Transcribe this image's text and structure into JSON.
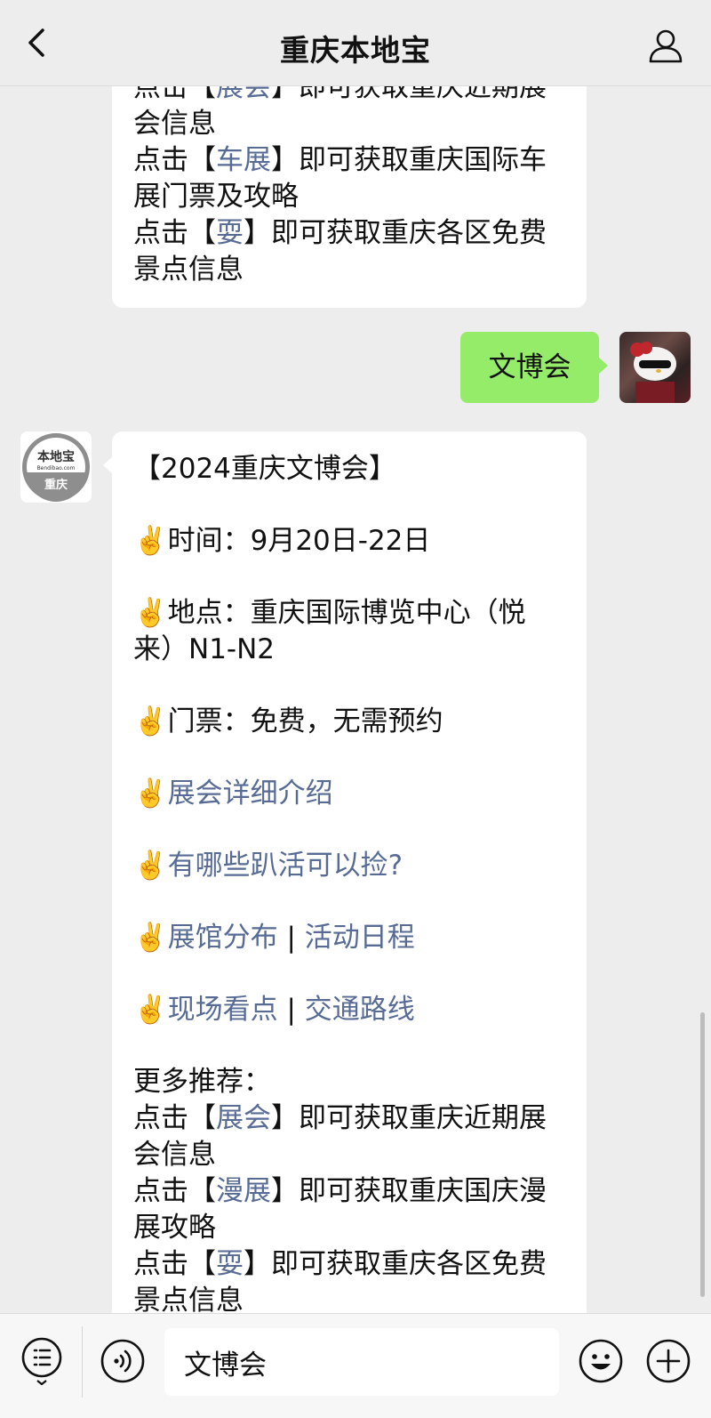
{
  "navbar": {
    "title": "重庆本地宝",
    "back_icon": "chevron-left-icon",
    "user_icon": "user-icon"
  },
  "previous_message": {
    "lines": [
      [
        {
          "t": "点击【"
        },
        {
          "t": "展会",
          "link": true
        },
        {
          "t": "】即可获取重庆近期展"
        }
      ],
      [
        {
          "t": "会信息"
        }
      ],
      [
        {
          "t": "点击【"
        },
        {
          "t": "车展",
          "link": true
        },
        {
          "t": "】即可获取重庆国际车"
        }
      ],
      [
        {
          "t": "展门票及攻略"
        }
      ],
      [
        {
          "t": "点击【"
        },
        {
          "t": "耍",
          "link": true
        },
        {
          "t": "】即可获取重庆各区免费"
        }
      ],
      [
        {
          "t": "景点信息"
        }
      ]
    ]
  },
  "user_message": {
    "text": "文博会",
    "avatar": "user-avatar"
  },
  "bot": {
    "avatar_top": "本地宝",
    "avatar_sub": "Bendibao.com",
    "avatar_bottom": "重庆"
  },
  "main_message": {
    "blocks": [
      [
        [
          {
            "t": "【2024重庆文博会】"
          }
        ]
      ],
      [
        [
          {
            "t": "✌️时间：9月20日-22日"
          }
        ]
      ],
      [
        [
          {
            "t": "✌️地点：重庆国际博览中心（悦"
          }
        ],
        [
          {
            "t": "来）N1-N2"
          }
        ]
      ],
      [
        [
          {
            "t": "✌️门票：免费，无需预约"
          }
        ]
      ],
      [
        [
          {
            "t": "✌️"
          },
          {
            "t": "展会详细介绍",
            "link": true
          }
        ]
      ],
      [
        [
          {
            "t": "✌️"
          },
          {
            "t": "有哪些趴活可以捡?",
            "link": true
          }
        ]
      ],
      [
        [
          {
            "t": "✌️"
          },
          {
            "t": "展馆分布",
            "link": true
          },
          {
            "t": " | "
          },
          {
            "t": "活动日程",
            "link": true
          }
        ]
      ],
      [
        [
          {
            "t": "✌️"
          },
          {
            "t": "现场看点",
            "link": true
          },
          {
            "t": " | "
          },
          {
            "t": "交通路线",
            "link": true
          }
        ]
      ],
      [
        [
          {
            "t": "更多推荐："
          }
        ],
        [
          {
            "t": "点击【"
          },
          {
            "t": "展会",
            "link": true
          },
          {
            "t": "】即可获取重庆近期展"
          }
        ],
        [
          {
            "t": "会信息"
          }
        ],
        [
          {
            "t": "点击【"
          },
          {
            "t": "漫展",
            "link": true
          },
          {
            "t": "】即可获取重庆国庆漫"
          }
        ],
        [
          {
            "t": "展攻略"
          }
        ],
        [
          {
            "t": "点击【"
          },
          {
            "t": "耍",
            "link": true
          },
          {
            "t": "】即可获取重庆各区免费"
          }
        ],
        [
          {
            "t": "景点信息"
          }
        ]
      ]
    ]
  },
  "input_bar": {
    "menu_icon": "menu-list-icon",
    "voice_icon": "voice-icon",
    "input_value": "文博会",
    "emoji_icon": "emoji-icon",
    "plus_icon": "plus-icon"
  },
  "colors": {
    "background": "#ededed",
    "link": "#576b95",
    "user_bubble": "#95ec69",
    "bubble": "#ffffff"
  }
}
